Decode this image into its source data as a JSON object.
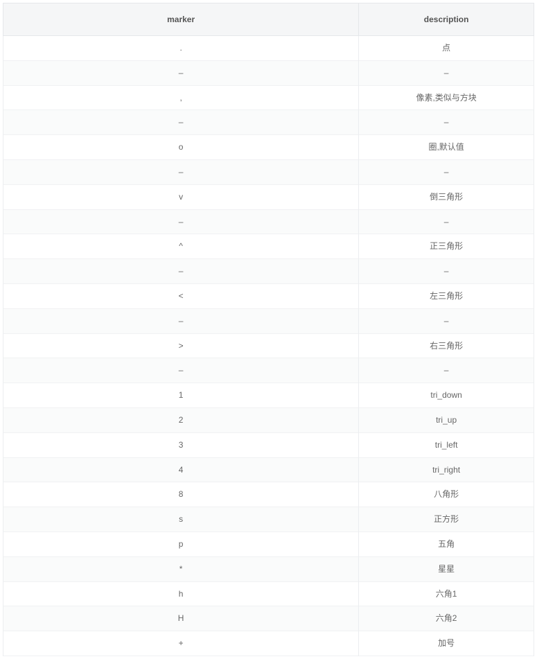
{
  "table": {
    "headers": {
      "marker": "marker",
      "description": "description"
    },
    "rows": [
      {
        "marker": ".",
        "description": "点"
      },
      {
        "marker": "–",
        "description": "–"
      },
      {
        "marker": ",",
        "description": "像素,类似与方块"
      },
      {
        "marker": "–",
        "description": "–"
      },
      {
        "marker": "o",
        "description": "圈,默认值"
      },
      {
        "marker": "–",
        "description": "–"
      },
      {
        "marker": "v",
        "description": "倒三角形"
      },
      {
        "marker": "–",
        "description": "–"
      },
      {
        "marker": "^",
        "description": "正三角形"
      },
      {
        "marker": "–",
        "description": "–"
      },
      {
        "marker": "<",
        "description": "左三角形"
      },
      {
        "marker": "–",
        "description": "–"
      },
      {
        "marker": ">",
        "description": "右三角形"
      },
      {
        "marker": "–",
        "description": "–"
      },
      {
        "marker": "1",
        "description": "tri_down"
      },
      {
        "marker": "2",
        "description": "tri_up"
      },
      {
        "marker": "3",
        "description": "tri_left"
      },
      {
        "marker": "4",
        "description": "tri_right"
      },
      {
        "marker": "8",
        "description": "八角形"
      },
      {
        "marker": "s",
        "description": "正方形"
      },
      {
        "marker": "p",
        "description": "五角"
      },
      {
        "marker": "*",
        "description": "星星"
      },
      {
        "marker": "h",
        "description": "六角1"
      },
      {
        "marker": "H",
        "description": "六角2"
      },
      {
        "marker": "+",
        "description": "加号"
      }
    ]
  }
}
